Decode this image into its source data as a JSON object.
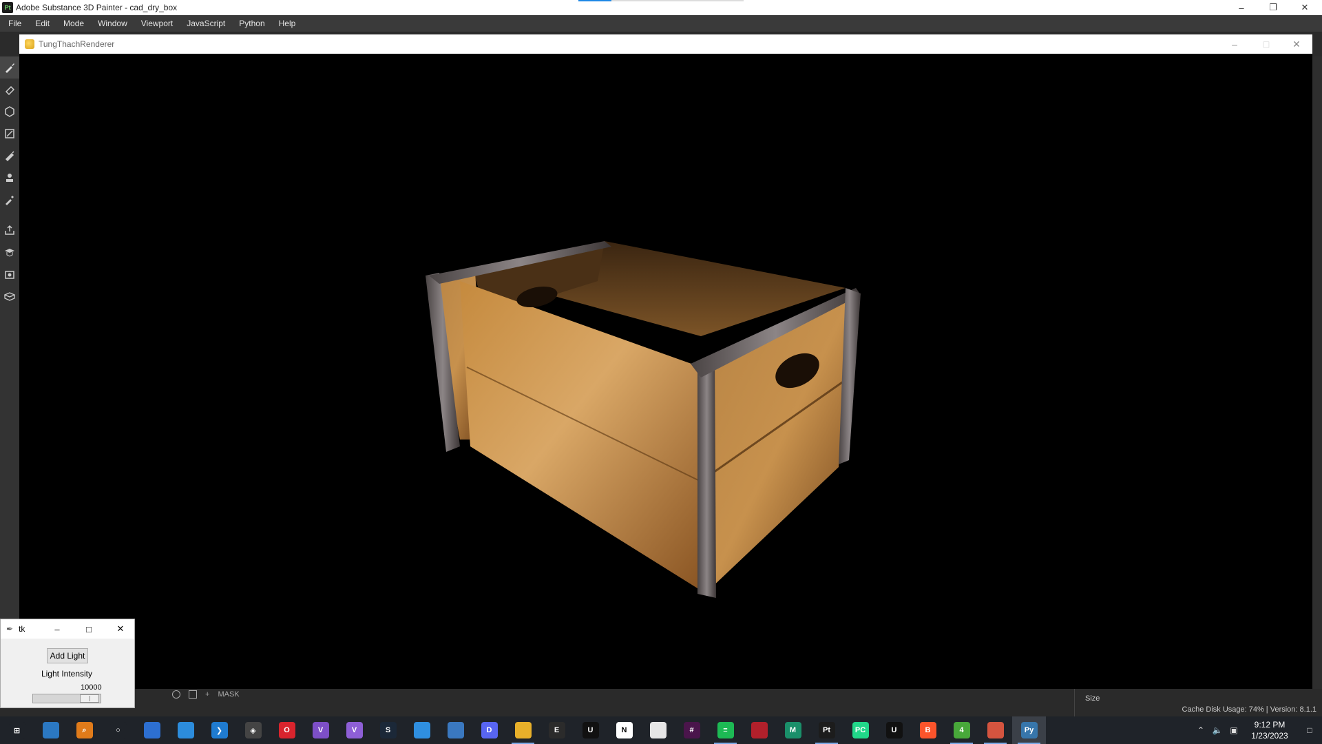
{
  "app": {
    "title": "Adobe Substance 3D Painter - cad_dry_box",
    "logo_text": "Pt"
  },
  "menu": [
    "File",
    "Edit",
    "Mode",
    "Window",
    "Viewport",
    "JavaScript",
    "Python",
    "Help"
  ],
  "renderer": {
    "title": "TungThachRenderer"
  },
  "bottom": {
    "mask_label": "MASK",
    "size_label": "Size",
    "status": "Cache Disk Usage:   74% | Version: 8.1.1"
  },
  "tk": {
    "title": "tk",
    "add_light_label": "Add Light",
    "intensity_label": "Light Intensity",
    "intensity_value": "10000"
  },
  "taskbar": {
    "apps": [
      {
        "name": "start-icon",
        "color": "#1f2329",
        "text": "⊞",
        "running": false
      },
      {
        "name": "app-icon-1",
        "color": "#2b78c2",
        "text": "",
        "running": false
      },
      {
        "name": "search-magnifier-icon",
        "color": "#e07b1a",
        "text": "⌕",
        "running": false
      },
      {
        "name": "search-icon",
        "color": "#1f2329",
        "text": "○",
        "running": false
      },
      {
        "name": "app-icon-4",
        "color": "#2d6fd1",
        "text": "",
        "running": false
      },
      {
        "name": "app-icon-5",
        "color": "#2c8cdc",
        "text": "",
        "running": false
      },
      {
        "name": "vscode-icon",
        "color": "#1f7bd0",
        "text": "❯",
        "running": false
      },
      {
        "name": "unity-icon",
        "color": "#444",
        "text": "◈",
        "running": false
      },
      {
        "name": "opera-icon",
        "color": "#d9242d",
        "text": "O",
        "running": false
      },
      {
        "name": "visual-studio-icon",
        "color": "#7d4fc7",
        "text": "V",
        "running": false
      },
      {
        "name": "visual-studio-preview-icon",
        "color": "#8e5fd6",
        "text": "V",
        "running": false
      },
      {
        "name": "steam-icon",
        "color": "#1b2838",
        "text": "S",
        "running": false
      },
      {
        "name": "app-icon-12",
        "color": "#2f8fe0",
        "text": "",
        "running": false
      },
      {
        "name": "app-icon-13",
        "color": "#3a78c0",
        "text": "",
        "running": false
      },
      {
        "name": "discord-icon",
        "color": "#5865f2",
        "text": "D",
        "running": false
      },
      {
        "name": "file-explorer-icon",
        "color": "#e8b02a",
        "text": "",
        "running": true
      },
      {
        "name": "epic-games-icon",
        "color": "#2b2b2b",
        "text": "E",
        "running": false
      },
      {
        "name": "unreal-icon",
        "color": "#111",
        "text": "U",
        "running": false
      },
      {
        "name": "notion-icon",
        "color": "#fff",
        "text": "N",
        "running": false
      },
      {
        "name": "app-icon-19",
        "color": "#e6e6e6",
        "text": "",
        "running": false
      },
      {
        "name": "slack-icon",
        "color": "#4a154b",
        "text": "#",
        "running": false
      },
      {
        "name": "spotify-icon",
        "color": "#1db954",
        "text": "≡",
        "running": true
      },
      {
        "name": "app-icon-22",
        "color": "#b1202b",
        "text": "",
        "running": false
      },
      {
        "name": "app-icon-23",
        "color": "#1a8f6a",
        "text": "M",
        "running": false
      },
      {
        "name": "substance-painter-icon",
        "color": "#1c1c1c",
        "text": "Pt",
        "running": true
      },
      {
        "name": "pycharm-icon",
        "color": "#21d789",
        "text": "PC",
        "running": false
      },
      {
        "name": "unreal-engine-icon",
        "color": "#111",
        "text": "U",
        "running": false
      },
      {
        "name": "brave-icon",
        "color": "#fb542b",
        "text": "B",
        "running": false
      },
      {
        "name": "app-icon-28",
        "color": "#48a83a",
        "text": "4",
        "running": true
      },
      {
        "name": "app-icon-29",
        "color": "#d4543f",
        "text": "",
        "running": true
      },
      {
        "name": "python-icon",
        "color": "#3776ab",
        "text": "Py",
        "running": true,
        "active": true
      }
    ],
    "clock_time": "9:12 PM",
    "clock_date": "1/23/2023"
  }
}
